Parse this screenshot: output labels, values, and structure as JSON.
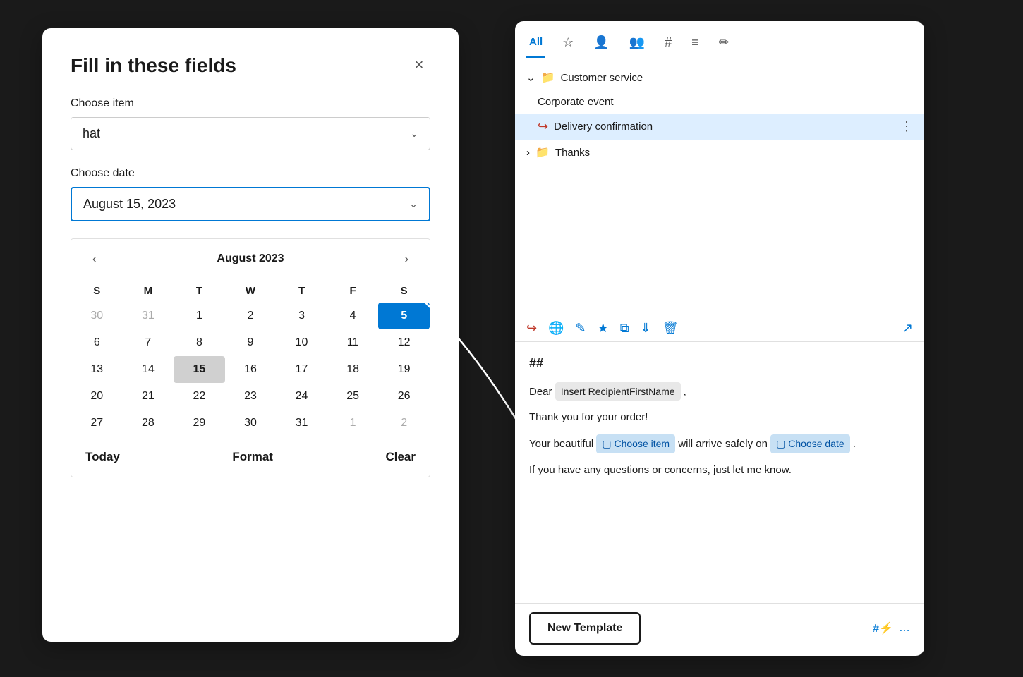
{
  "leftPanel": {
    "title": "Fill in these fields",
    "closeLabel": "×",
    "chooseItemLabel": "Choose item",
    "chooseItemValue": "hat",
    "chooseDateLabel": "Choose date",
    "chooseDateValue": "August 15, 2023",
    "calendar": {
      "monthLabel": "August 2023",
      "prevArrow": "‹",
      "nextArrow": "›",
      "dayHeaders": [
        "S",
        "M",
        "T",
        "W",
        "T",
        "F",
        "S"
      ],
      "weeks": [
        [
          "30",
          "31",
          "1",
          "2",
          "3",
          "4",
          "5"
        ],
        [
          "6",
          "7",
          "8",
          "9",
          "10",
          "11",
          "12"
        ],
        [
          "13",
          "14",
          "15",
          "16",
          "17",
          "18",
          "19"
        ],
        [
          "20",
          "21",
          "22",
          "23",
          "24",
          "25",
          "26"
        ],
        [
          "27",
          "28",
          "29",
          "30",
          "31",
          "1",
          "2"
        ]
      ],
      "footerToday": "Today",
      "footerFormat": "Format",
      "footerClear": "Clear"
    }
  },
  "rightPanel": {
    "tabs": [
      {
        "label": "All",
        "id": "all",
        "active": true
      },
      {
        "label": "★",
        "id": "star"
      },
      {
        "label": "👤",
        "id": "person"
      },
      {
        "label": "👥",
        "id": "group"
      },
      {
        "label": "#",
        "id": "hash"
      },
      {
        "label": "📋",
        "id": "list"
      },
      {
        "label": "✏️",
        "id": "edit"
      }
    ],
    "treeItems": [
      {
        "label": "Customer service",
        "type": "folder",
        "expanded": true,
        "indent": 0
      },
      {
        "label": "Corporate event",
        "type": "item",
        "indent": 1
      },
      {
        "label": "Delivery confirmation",
        "type": "item-icon",
        "indent": 1,
        "selected": true
      },
      {
        "label": "Thanks",
        "type": "folder",
        "indent": 0,
        "expanded": false
      }
    ],
    "toolbarIcons": [
      "insert",
      "globe",
      "pencil",
      "star",
      "copy",
      "download",
      "trash",
      "expand"
    ],
    "emailContent": {
      "hashMark": "##",
      "line1Start": "Dear ",
      "insertName": "Insert RecipientFirstName",
      "line1End": ",",
      "line2": "Thank you for your order!",
      "line3Start": "Your beautiful ",
      "chooseItemTag": "Choose item",
      "line3Mid": " will arrive safely on ",
      "chooseDateTag": "Choose date",
      "line3End": ".",
      "line4": "If you have any questions or concerns, just let me know."
    },
    "newTemplateBtn": "New Template",
    "bottomIcons": [
      "#⚡",
      "..."
    ]
  }
}
